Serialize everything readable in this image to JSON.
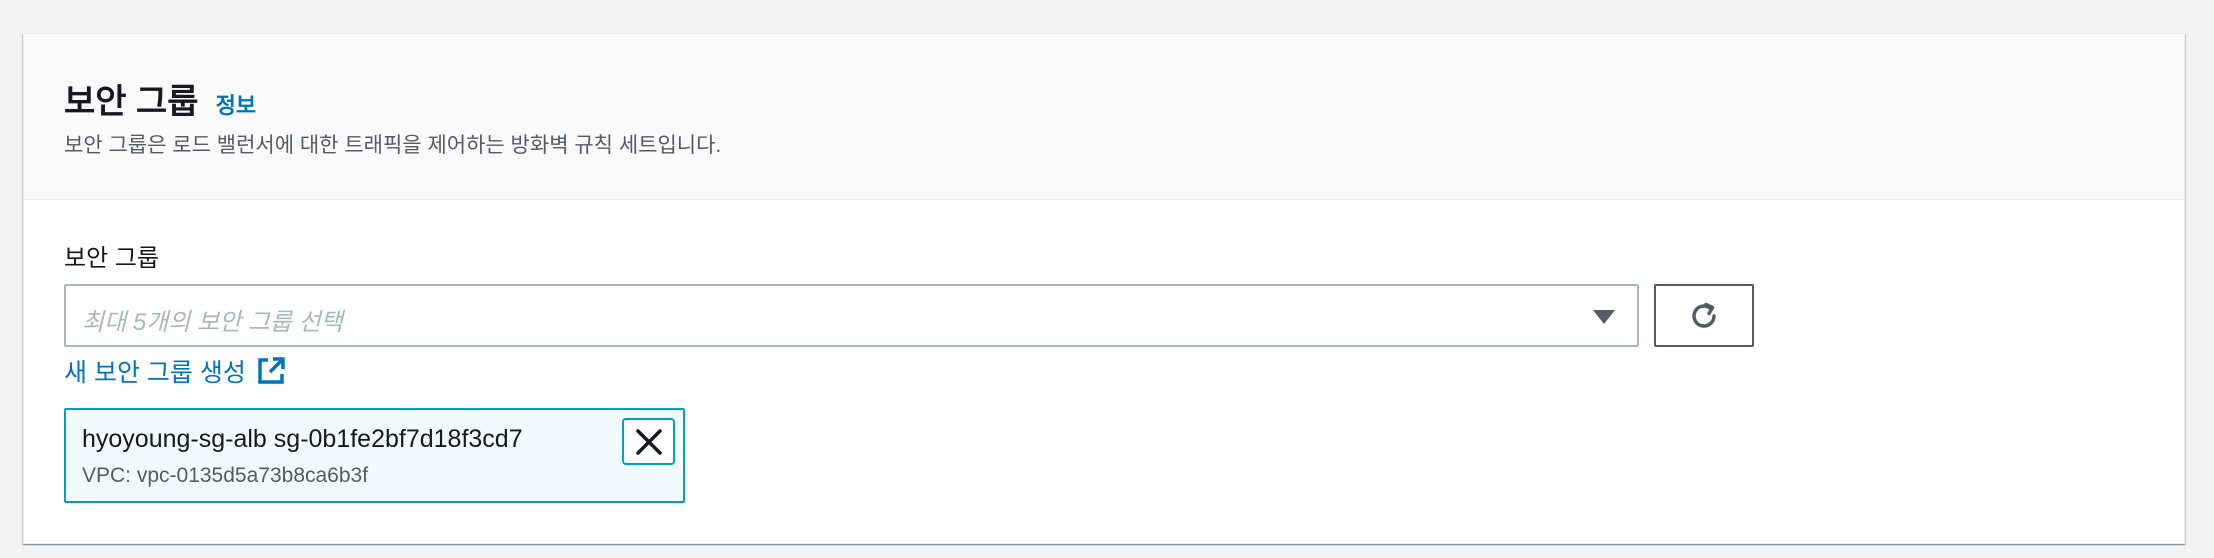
{
  "section": {
    "title": "보안 그룹",
    "info_link": "정보",
    "description": "보안 그룹은 로드 밸런서에 대한 트래픽을 제어하는 방화벽 규칙 세트입니다."
  },
  "field": {
    "label": "보안 그룹",
    "placeholder": "최대 5개의 보안 그룹 선택",
    "create_link": "새 보안 그룹 생성"
  },
  "selected_token": {
    "name": "hyoyoung-sg-alb  sg-0b1fe2bf7d18f3cd7",
    "vpc": "VPC: vpc-0135d5a73b8ca6b3f"
  },
  "icons": {
    "dropdown": "caret-down-icon",
    "refresh": "refresh-icon",
    "external": "external-link-icon",
    "remove": "close-icon"
  },
  "colors": {
    "link": "#0073bb",
    "token_border": "#00a1c9",
    "token_bg": "#f1faff"
  }
}
